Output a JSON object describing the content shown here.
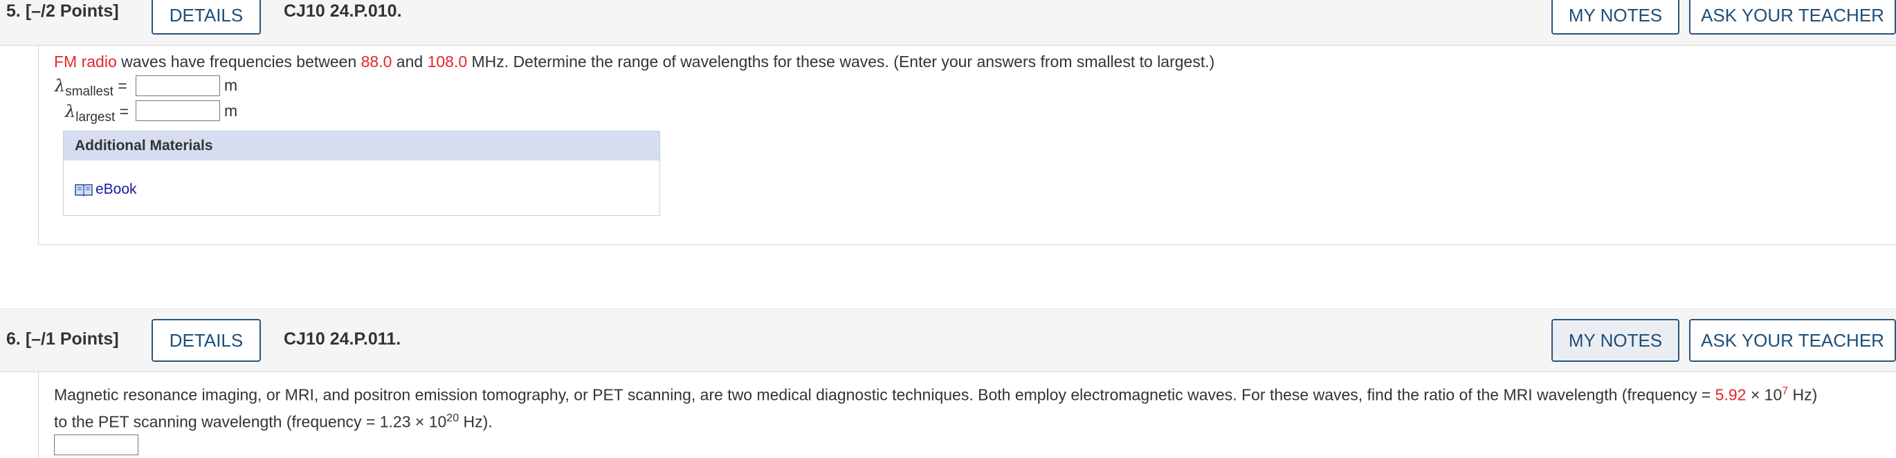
{
  "q5": {
    "number": "5.",
    "points": "[–/2 Points]",
    "details_label": "DETAILS",
    "code": "CJ10 24.P.010.",
    "my_notes_label": "MY NOTES",
    "ask_teacher_label": "ASK YOUR TEACHER",
    "text": {
      "fm_radio": "FM radio",
      "part1": " waves have frequencies between ",
      "f1": "88.0",
      "part2": " and ",
      "f2": "108.0",
      "part3": " MHz. Determine the range of wavelengths for these waves. (Enter your answers from smallest to largest.)"
    },
    "answers": [
      {
        "symbol": "λ",
        "subscript": "smallest",
        "eq": "=",
        "value": "",
        "unit": "m"
      },
      {
        "symbol": "λ",
        "subscript": "largest",
        "eq": "=",
        "value": "",
        "unit": "m"
      }
    ],
    "additional_materials": {
      "title": "Additional Materials",
      "ebook_label": "eBook",
      "ebook_icon": "book-icon"
    }
  },
  "q6": {
    "number": "6.",
    "points": "[–/1 Points]",
    "details_label": "DETAILS",
    "code": "CJ10 24.P.011.",
    "my_notes_label": "MY NOTES",
    "ask_teacher_label": "ASK YOUR TEACHER",
    "text": {
      "line1_part1": "Magnetic resonance imaging, or MRI, and positron emission tomography, or PET scanning, are two medical diagnostic techniques. Both employ electromagnetic waves. For these waves, find the ratio of the MRI wavelength (frequency = ",
      "mri_mantissa": "5.92",
      "times": " × 10",
      "mri_exp": "7",
      "line1_end": " Hz)",
      "line2_part1": "to the PET scanning wavelength (frequency = 1.23 × 10",
      "pet_exp": "20",
      "line2_end": " Hz)."
    },
    "answer_value": ""
  },
  "colors": {
    "accent": "#1e4e79",
    "highlight_red": "#e3262b",
    "header_bg": "#f5f5f5",
    "materials_header_bg": "#d7ddf1"
  }
}
